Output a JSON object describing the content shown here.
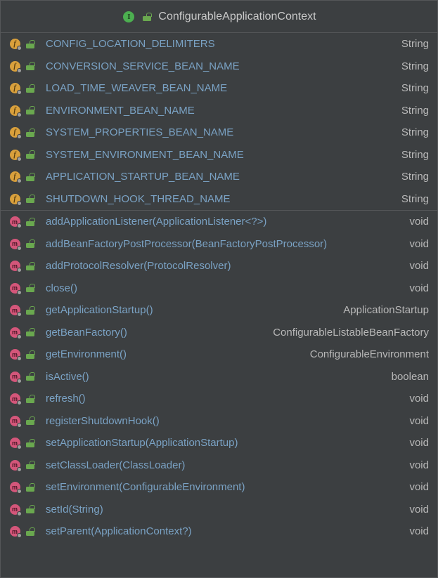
{
  "header": {
    "title": "ConfigurableApplicationContext"
  },
  "fields": [
    {
      "name": "CONFIG_LOCATION_DELIMITERS",
      "type": "String"
    },
    {
      "name": "CONVERSION_SERVICE_BEAN_NAME",
      "type": "String"
    },
    {
      "name": "LOAD_TIME_WEAVER_BEAN_NAME",
      "type": "String"
    },
    {
      "name": "ENVIRONMENT_BEAN_NAME",
      "type": "String"
    },
    {
      "name": "SYSTEM_PROPERTIES_BEAN_NAME",
      "type": "String"
    },
    {
      "name": "SYSTEM_ENVIRONMENT_BEAN_NAME",
      "type": "String"
    },
    {
      "name": "APPLICATION_STARTUP_BEAN_NAME",
      "type": "String"
    },
    {
      "name": "SHUTDOWN_HOOK_THREAD_NAME",
      "type": "String"
    }
  ],
  "methods": [
    {
      "name": "addApplicationListener(ApplicationListener<?>)",
      "type": "void"
    },
    {
      "name": "addBeanFactoryPostProcessor(BeanFactoryPostProcessor)",
      "type": "void"
    },
    {
      "name": "addProtocolResolver(ProtocolResolver)",
      "type": "void"
    },
    {
      "name": "close()",
      "type": "void"
    },
    {
      "name": "getApplicationStartup()",
      "type": "ApplicationStartup"
    },
    {
      "name": "getBeanFactory()",
      "type": "ConfigurableListableBeanFactory"
    },
    {
      "name": "getEnvironment()",
      "type": "ConfigurableEnvironment"
    },
    {
      "name": "isActive()",
      "type": "boolean"
    },
    {
      "name": "refresh()",
      "type": "void"
    },
    {
      "name": "registerShutdownHook()",
      "type": "void"
    },
    {
      "name": "setApplicationStartup(ApplicationStartup)",
      "type": "void"
    },
    {
      "name": "setClassLoader(ClassLoader)",
      "type": "void"
    },
    {
      "name": "setEnvironment(ConfigurableEnvironment)",
      "type": "void"
    },
    {
      "name": "setId(String)",
      "type": "void"
    },
    {
      "name": "setParent(ApplicationContext?)",
      "type": "void"
    }
  ]
}
